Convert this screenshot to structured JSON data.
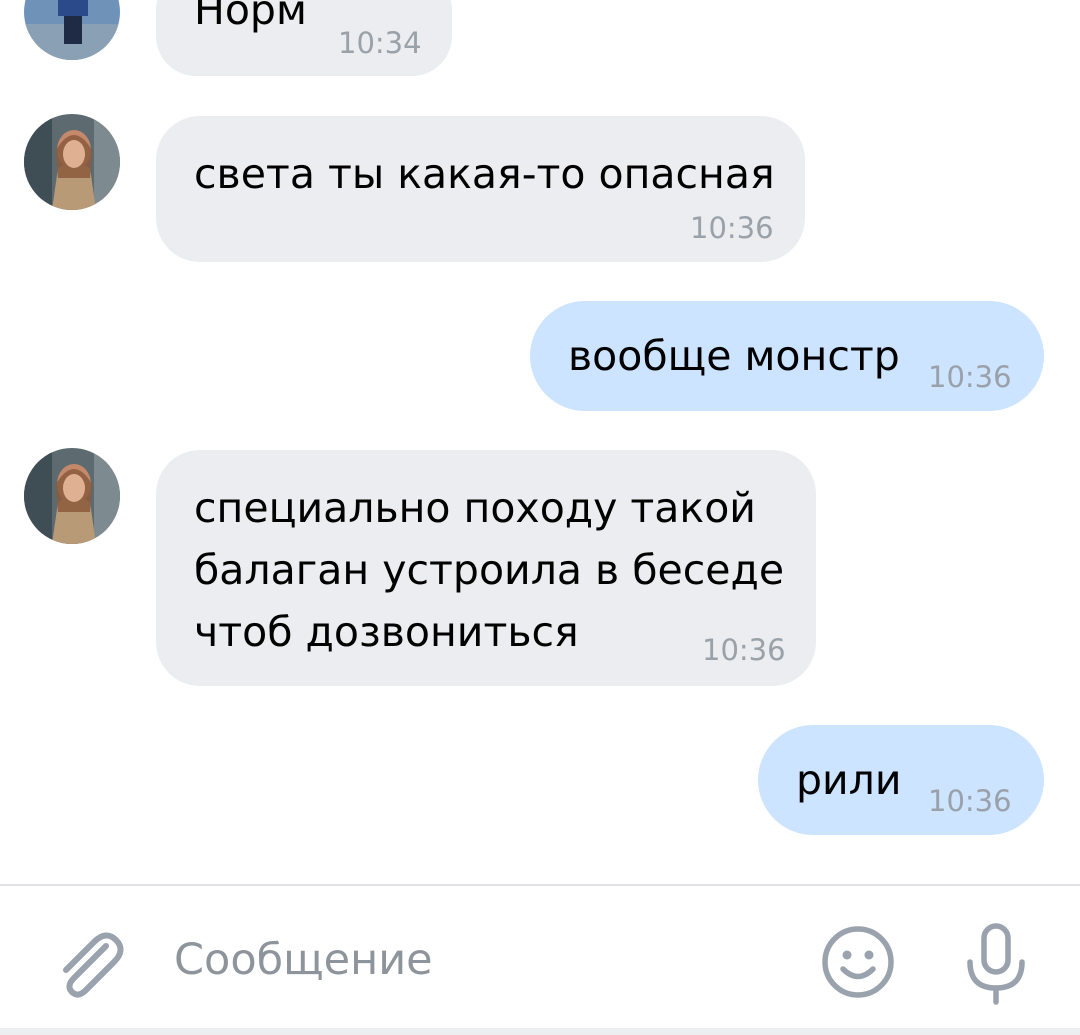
{
  "messages": [
    {
      "direction": "incoming",
      "text": "Норм",
      "time": "10:34"
    },
    {
      "direction": "incoming",
      "text": "света ты какая-то опасная",
      "time": "10:36"
    },
    {
      "direction": "outgoing",
      "text": "вообще монстр",
      "time": "10:36"
    },
    {
      "direction": "incoming",
      "lines": [
        "специально походу такой",
        "балаган устроила в беседе",
        "чтоб дозвониться"
      ],
      "time": "10:36"
    },
    {
      "direction": "outgoing",
      "text": "рили",
      "time": "10:36"
    }
  ],
  "composer": {
    "placeholder": "Сообщение",
    "value": "",
    "icons": [
      "paperclip-icon",
      "smile-icon",
      "microphone-icon"
    ]
  },
  "colors": {
    "incoming_bubble": "#ebedf0",
    "outgoing_bubble": "#cce4ff",
    "time_text": "#9aa1a9",
    "icon": "#99a2ad"
  }
}
